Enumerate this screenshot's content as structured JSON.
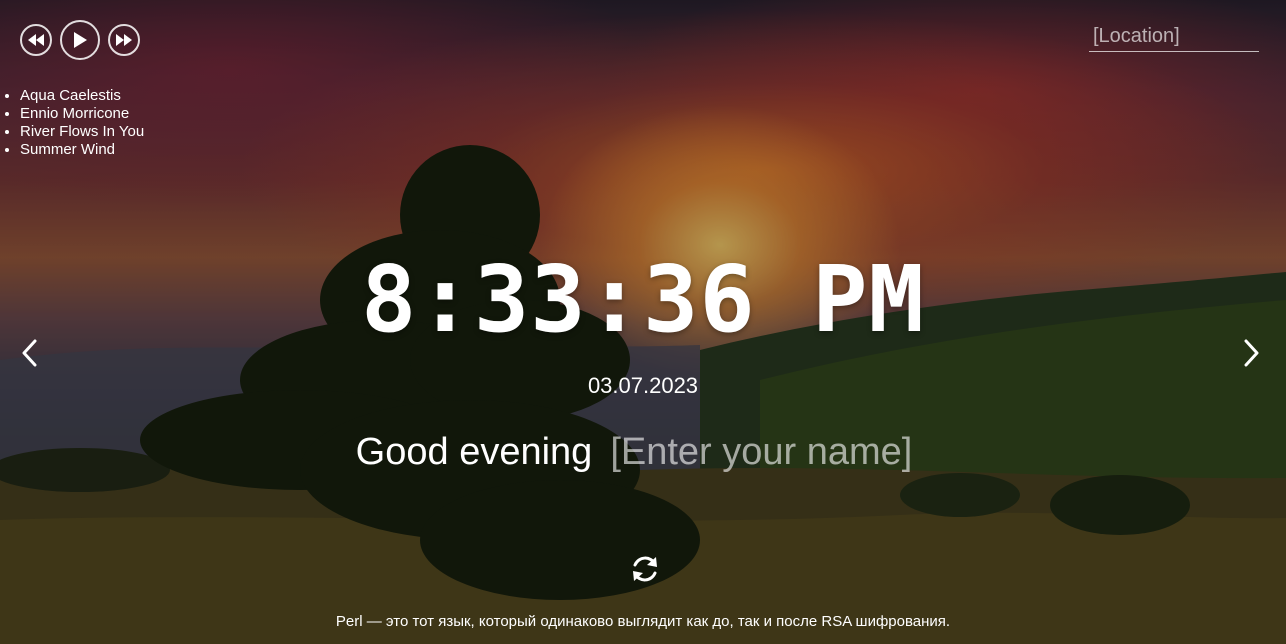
{
  "player": {
    "prev_icon": "rewind-icon",
    "play_icon": "play-icon",
    "next_icon": "fast-forward-icon"
  },
  "playlist": [
    "Aqua Caelestis",
    "Ennio Morricone",
    "River Flows In You",
    "Summer Wind"
  ],
  "weather": {
    "location_placeholder": "[Location]"
  },
  "clock": {
    "time": "8:33:36 PM",
    "date": "03.07.2023"
  },
  "greeting": {
    "text": "Good evening",
    "name_placeholder": "[Enter your name]"
  },
  "slider": {
    "prev_icon": "chevron-left-icon",
    "next_icon": "chevron-right-icon"
  },
  "quote": {
    "refresh_icon": "refresh-icon",
    "text": "Perl — это тот язык, который одинаково выглядит как до, так и после RSA шифрования."
  },
  "colors": {
    "text": "#ffffff",
    "sunset_glow": "#ffb24a",
    "sky_top": "#2a2230"
  }
}
